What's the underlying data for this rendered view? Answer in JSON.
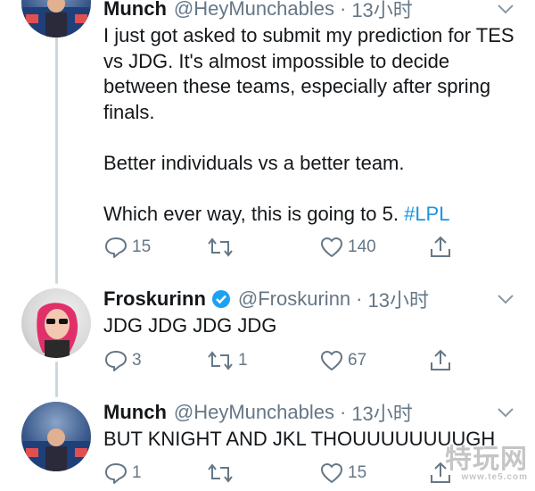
{
  "tweets": [
    {
      "name": "Munch",
      "handle": "@HeyMunchables",
      "separator": "·",
      "time": "13小时",
      "text_before_tag": "I just got asked to submit my prediction for TES vs JDG. It's almost impossible to decide between these teams, especially after spring finals.\n\nBetter individuals vs a better team.\n\nWhich ever way, this is going to 5. ",
      "hashtag": "#LPL",
      "replies": "15",
      "retweets": "",
      "likes": "140",
      "verified": false
    },
    {
      "name": "Froskurinn",
      "handle": "@Froskurinn",
      "separator": "·",
      "time": "13小时",
      "text": "JDG JDG JDG JDG",
      "replies": "3",
      "retweets": "1",
      "likes": "67",
      "verified": true
    },
    {
      "name": "Munch",
      "handle": "@HeyMunchables",
      "separator": "·",
      "time": "13小时",
      "text": "BUT KNIGHT AND JKL THOUUUUUUUUGH",
      "replies": "1",
      "retweets": "",
      "likes": "15",
      "verified": false
    }
  ],
  "watermark": {
    "main": "特玩网",
    "sub": "www.te5.com"
  },
  "colors": {
    "accent": "#1b95e0",
    "secondary": "#657786",
    "line": "#ccd6dd"
  },
  "icons": [
    "reply-icon",
    "retweet-icon",
    "like-icon",
    "share-icon",
    "verified-badge-icon",
    "caret-down-icon"
  ]
}
